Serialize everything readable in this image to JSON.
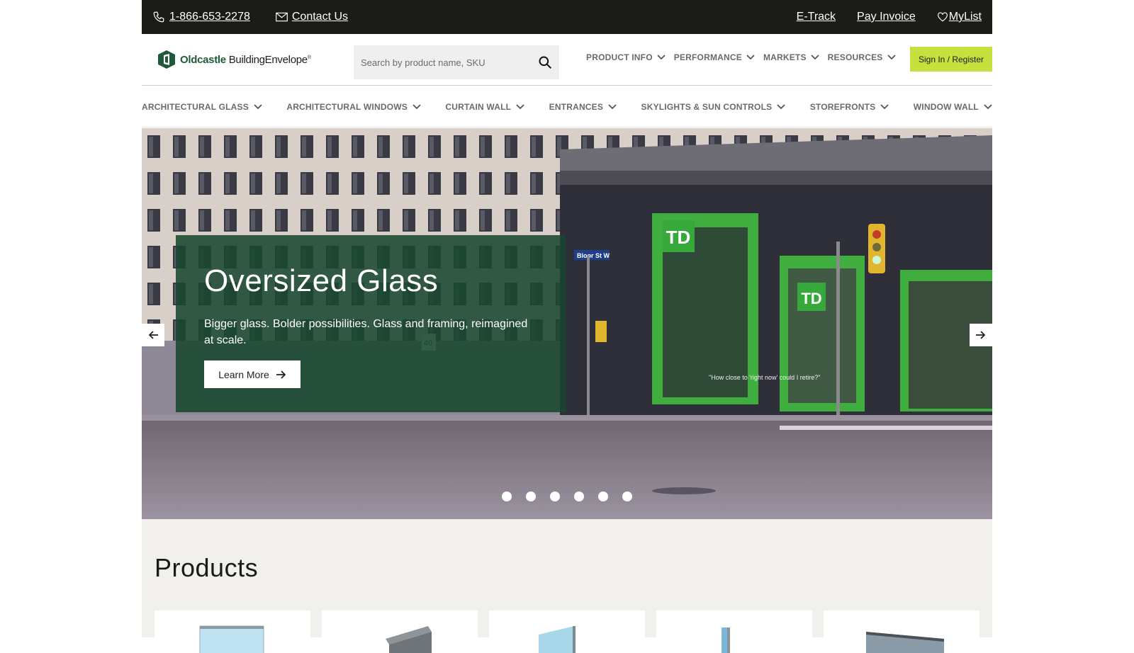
{
  "topbar": {
    "phone": " 1-866-653-2278",
    "contact": " Contact Us",
    "etrack": "E-Track",
    "pay_invoice": "Pay Invoice",
    "mylist": " MyList"
  },
  "header": {
    "logo_bold": "Oldcastle",
    "logo_rest": " BuildingEnvelope",
    "logo_mark": "®",
    "search_placeholder": "Search by product name, SKU",
    "nav": [
      "PRODUCT INFO",
      "PERFORMANCE",
      "MARKETS",
      "RESOURCES"
    ],
    "signin": "Sign In / Register"
  },
  "categories": [
    "ARCHITECTURAL GLASS",
    "ARCHITECTURAL WINDOWS",
    "CURTAIN WALL",
    "ENTRANCES",
    "SKYLIGHTS & SUN CONTROLS",
    "STOREFRONTS",
    "WINDOW WALL"
  ],
  "hero": {
    "title": "Oversized Glass",
    "text": "Bigger glass. Bolder possibilities. Glass and framing, reimagined at scale.",
    "cta": "Learn More",
    "slide_count": 6,
    "scene_text": {
      "street_sign": "Bloor St W",
      "bank_logo": "TD",
      "poster": "\"How close to 'right now' could I retire?\"",
      "speed": "40"
    }
  },
  "products": {
    "title": "Products"
  },
  "colors": {
    "topbar": "#1b1b17",
    "accent": "#c7e03d",
    "hero_card": "#184830",
    "brand_green": "#1f5b3a"
  }
}
